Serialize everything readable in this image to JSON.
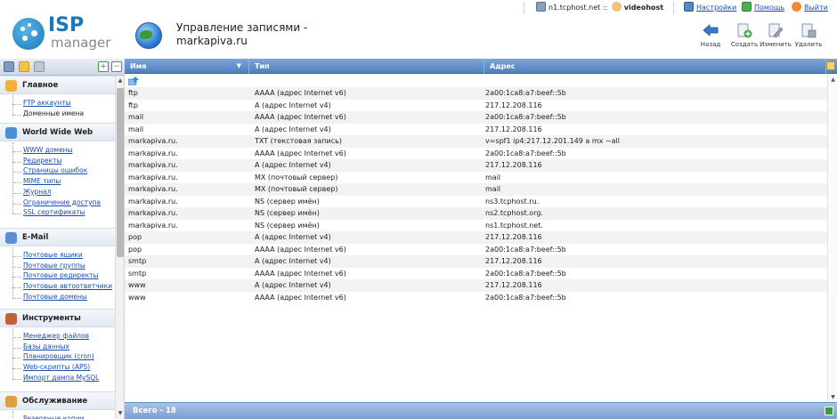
{
  "app": {
    "logo_text": "ISP",
    "logo_sub": "manager"
  },
  "header": {
    "title_line1": "Управление записями -",
    "title_line2": "markapiva.ru"
  },
  "topbar": {
    "server": "n1.tcphost.net ::",
    "user": "videohost",
    "settings": "Настройки",
    "help": "Помощь",
    "logout": "Выйти"
  },
  "actions": {
    "back": "Назад",
    "create": "Создать",
    "edit": "Изменить",
    "delete": "Удалить"
  },
  "sidebar": {
    "sections": [
      {
        "title": "Главное",
        "icon": "home-icon",
        "items": [
          "FTP аккаунты",
          "Доменные имена"
        ],
        "active_index": 1
      },
      {
        "title": "World Wide Web",
        "icon": "globe-icon",
        "items": [
          "WWW домены",
          "Редиректы",
          "Страницы ошибок",
          "MIME типы",
          "Журнал",
          "Ограничение доступа",
          "SSL сертификаты"
        ],
        "active_index": -1
      },
      {
        "title": "E-Mail",
        "icon": "mail-icon",
        "items": [
          "Почтовые ящики",
          "Почтовые группы",
          "Почтовые редиректы",
          "Почтовые автоответчики",
          "Почтовые домены"
        ],
        "active_index": -1
      },
      {
        "title": "Инструменты",
        "icon": "tools-icon",
        "items": [
          "Менеджер файлов",
          "Базы данных",
          "Планировщик (cron)",
          "Web-скрипты (APS)",
          "Импорт дампа MySQL"
        ],
        "active_index": -1
      },
      {
        "title": "Обслуживание",
        "icon": "service-icon",
        "items": [
          "Резервные копии"
        ],
        "active_index": -1
      }
    ]
  },
  "table": {
    "columns": [
      "Имя",
      "Тип",
      "Адрес"
    ],
    "rows": [
      [
        "ftp",
        "AAAA (адрес Internet v6)",
        "2a00:1ca8:a7:beef::5b"
      ],
      [
        "ftp",
        "A (адрес Internet v4)",
        "217.12.208.116"
      ],
      [
        "mail",
        "AAAA (адрес Internet v6)",
        "2a00:1ca8:a7:beef::5b"
      ],
      [
        "mail",
        "A (адрес Internet v4)",
        "217.12.208.116"
      ],
      [
        "markapiva.ru.",
        "TXT (текстовая запись)",
        "v=spf1 ip4:217.12.201.149 a mx ~all"
      ],
      [
        "markapiva.ru.",
        "AAAA (адрес Internet v6)",
        "2a00:1ca8:a7:beef::5b"
      ],
      [
        "markapiva.ru.",
        "A (адрес Internet v4)",
        "217.12.208.116"
      ],
      [
        "markapiva.ru.",
        "MX (почтовый сервер)",
        "mail"
      ],
      [
        "markapiva.ru.",
        "MX (почтовый сервер)",
        "mail"
      ],
      [
        "markapiva.ru.",
        "NS (сервер имён)",
        "ns3.tcphost.ru."
      ],
      [
        "markapiva.ru.",
        "NS (сервер имён)",
        "ns2.tcphost.org."
      ],
      [
        "markapiva.ru.",
        "NS (сервер имён)",
        "ns1.tcphost.net."
      ],
      [
        "pop",
        "A (адрес Internet v4)",
        "217.12.208.116"
      ],
      [
        "pop",
        "AAAA (адрес Internet v6)",
        "2a00:1ca8:a7:beef::5b"
      ],
      [
        "smtp",
        "A (адрес Internet v4)",
        "217.12.208.116"
      ],
      [
        "smtp",
        "AAAA (адрес Internet v6)",
        "2a00:1ca8:a7:beef::5b"
      ],
      [
        "www",
        "A (адрес Internet v4)",
        "217.12.208.116"
      ],
      [
        "www",
        "AAAA (адрес Internet v6)",
        "2a00:1ca8:a7:beef::5b"
      ]
    ],
    "footer": "Всего - 18"
  }
}
